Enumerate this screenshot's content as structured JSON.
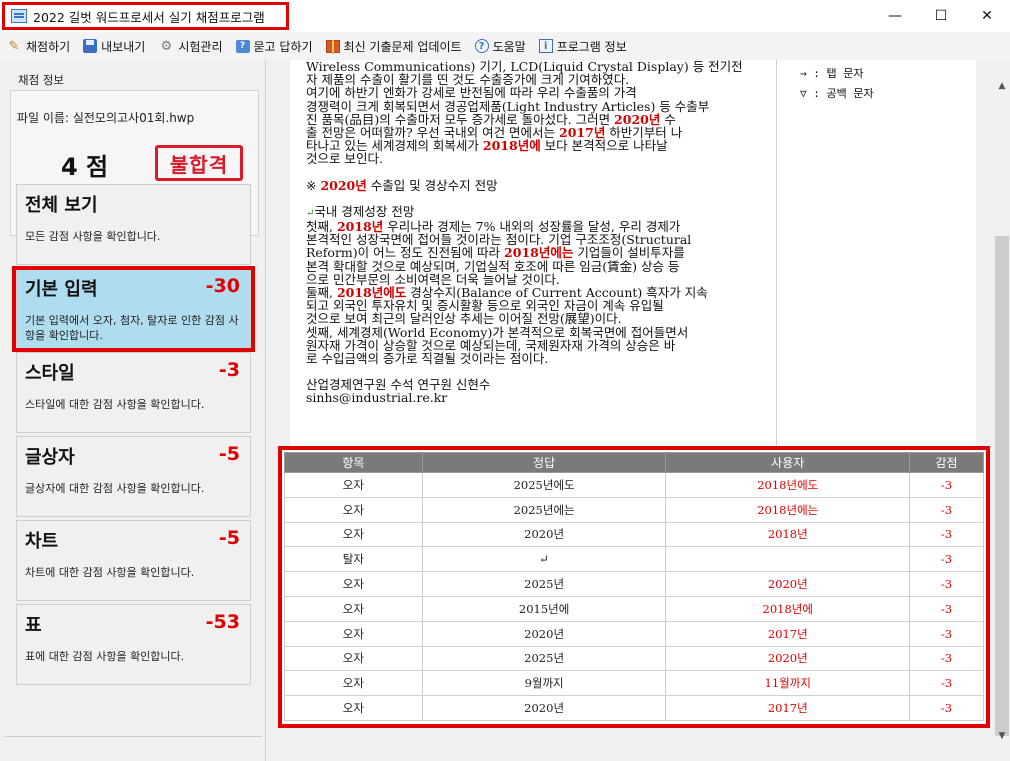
{
  "window": {
    "title": "2022 길벗 워드프로세서 실기 채점프로그램",
    "minimize": "—",
    "maximize": "☐",
    "close": "✕"
  },
  "toolbar": {
    "items": [
      {
        "label": "채점하기",
        "icon": "pencil-icon"
      },
      {
        "label": "내보내기",
        "icon": "save-icon"
      },
      {
        "label": "시험관리",
        "icon": "gear-icon"
      },
      {
        "label": "묻고 답하기",
        "icon": "qa-icon"
      },
      {
        "label": "최신 기출문제 업데이트",
        "icon": "gift-icon"
      },
      {
        "label": "도움말",
        "icon": "help-icon"
      },
      {
        "label": "프로그램 정보",
        "icon": "info-icon"
      }
    ]
  },
  "score_info": {
    "legend": "채점 정보",
    "file_label": "파일 이름: 실전모의고사01회.hwp",
    "score": "4 점",
    "result_stamp": "불합격"
  },
  "categories": [
    {
      "title": "전체 보기",
      "score": "",
      "desc": "모든 감점 사항을 확인합니다."
    },
    {
      "title": "기본 입력",
      "score": "-30",
      "desc": "기본 입력에서 오자, 첨자, 탈자로 인한 감점 사항을 확인합니다."
    },
    {
      "title": "스타일",
      "score": "-3",
      "desc": "스타일에 대한 감점 사항을 확인합니다."
    },
    {
      "title": "글상자",
      "score": "-5",
      "desc": "글상자에 대한 감점 사항을 확인합니다."
    },
    {
      "title": "차트",
      "score": "-5",
      "desc": "차트에 대한 감점 사항을 확인합니다."
    },
    {
      "title": "표",
      "score": "-53",
      "desc": "표에 대한 감점 사항을 확인합니다."
    }
  ],
  "document": {
    "lines": [
      [
        {
          "t": "Wireless Communications) 기기, LCD(Liquid Crystal Display) 등 전기전"
        }
      ],
      [
        {
          "t": "자 제품의 수출이 활기를 띤 것도 수출증가에 크게 기여하였다."
        }
      ],
      [
        {
          "t": "여기에 하반기 엔화가 강세로 반전됨에 따라 우리 수출품의 가격"
        }
      ],
      [
        {
          "t": "경쟁력이 크게 회복되면서 경공업제품(Light Industry Articles) 등 수출부"
        }
      ],
      [
        {
          "t": "진 품목(品目)의 수출마저 모두 증가세로 돌아섰다. 그러면 "
        },
        {
          "t": "2020년",
          "r": true
        },
        {
          "t": " 수"
        }
      ],
      [
        {
          "t": "출 전망은 어떠할까? 우선 국내외 여건 면에서는 "
        },
        {
          "t": "2017년",
          "r": true
        },
        {
          "t": " 하반기부터 나"
        }
      ],
      [
        {
          "t": "타나고 있는 세계경제의 회복세가 "
        },
        {
          "t": "2018년에",
          "r": true
        },
        {
          "t": " 보다 본격적으로 나타날"
        }
      ],
      [
        {
          "t": "것으로 보인다."
        }
      ],
      [],
      [
        {
          "t": "※ "
        },
        {
          "t": "2020년",
          "r": true
        },
        {
          "t": " 수출입 및 경상수지 전망"
        }
      ],
      [],
      [
        {
          "t": "↵",
          "m": true
        },
        {
          "t": "국내 경제성장 전망"
        }
      ],
      [
        {
          "t": "첫째, "
        },
        {
          "t": "2018년",
          "r": true
        },
        {
          "t": " 우리나라 경제는 7% 내외의 성장률을 달성, 우리 경제가"
        }
      ],
      [
        {
          "t": "본격적인 성장국면에 접어들 것이라는 점이다. 기업 구조조정(Structural"
        }
      ],
      [
        {
          "t": "Reform)이 어느 정도 진전됨에 따라 "
        },
        {
          "t": "2018년에는",
          "r": true
        },
        {
          "t": " 기업들이 설비투자를"
        }
      ],
      [
        {
          "t": "본격 확대할 것으로 예상되며, 기업실적 호조에 따른 임금(賃金) 상승 등"
        }
      ],
      [
        {
          "t": "으로 민간부문의 소비여력은 더욱 늘어날 것이다."
        }
      ],
      [
        {
          "t": "둘째, "
        },
        {
          "t": "2018년에도",
          "r": true
        },
        {
          "t": " 경상수지(Balance of Current Account) 흑자가 지속"
        }
      ],
      [
        {
          "t": "되고 외국인 투자유치 및 증시활황 등으로 외국인 자금이 계속 유입될"
        }
      ],
      [
        {
          "t": "것으로 보여 최근의 달러인상 추세는 이어질 전망(展望)이다."
        }
      ],
      [
        {
          "t": "셋째, 세계경제(World Economy)가 본격적으로 회복국면에 접어들면서"
        }
      ],
      [
        {
          "t": "원자재 가격이 상승할 것으로 예상되는데, 국제원자재 가격의 상승은 바"
        }
      ],
      [
        {
          "t": "로 수입금액의 증가로 직결될 것이라는 점이다."
        }
      ],
      [],
      [
        {
          "t": "산업경제연구원 수석 연구원 신현수"
        }
      ],
      [
        {
          "t": "sinhs@industrial.re.kr"
        }
      ]
    ],
    "legend_lines": [
      "→ : 탭 문자",
      "▽ : 공백 문자"
    ]
  },
  "table": {
    "headers": [
      "항목",
      "정답",
      "사용자",
      "감점"
    ],
    "rows": [
      [
        "오자",
        "2025년에도",
        "2018년에도",
        "-3"
      ],
      [
        "오자",
        "2025년에는",
        "2018년에는",
        "-3"
      ],
      [
        "오자",
        "2020년",
        "2018년",
        "-3"
      ],
      [
        "탈자",
        "↵",
        "",
        "-3"
      ],
      [
        "오자",
        "2025년",
        "2020년",
        "-3"
      ],
      [
        "오자",
        "2015년에",
        "2018년에",
        "-3"
      ],
      [
        "오자",
        "2020년",
        "2017년",
        "-3"
      ],
      [
        "오자",
        "2025년",
        "2020년",
        "-3"
      ],
      [
        "오자",
        "9월까지",
        "11월까지",
        "-3"
      ],
      [
        "오자",
        "2020년",
        "2017년",
        "-3"
      ]
    ]
  },
  "colors": {
    "accent_red": "#e00000",
    "active_category": "#b0dcf0",
    "table_header": "#7a7a7a"
  }
}
